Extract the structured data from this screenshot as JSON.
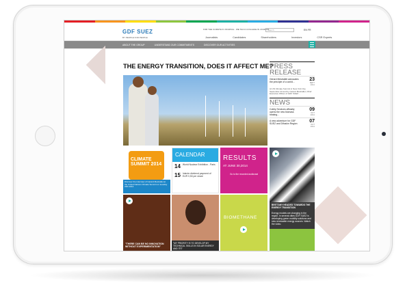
{
  "site": {
    "brand_colors": [
      "#e31e24",
      "#f7941d",
      "#ffdd00",
      "#8dc63f",
      "#00a651",
      "#1cb0a4",
      "#29abe2",
      "#2e3192",
      "#92278f",
      "#d0238b"
    ],
    "logo": "GDF SUEZ",
    "tagline": "BY PEOPLE FOR PEOPLE",
    "utility_links": "FOR THE CLIMATE IN JOURNAL · WE TALK A COLLEGE IN JOURNAL",
    "search_placeholder": "Search",
    "language": "EN FR",
    "main_nav": [
      "Journalists",
      "Candidates",
      "Shareholders",
      "Investors",
      "CSR Experts"
    ],
    "sub_nav": [
      "ABOUT THE GROUP",
      "UNDERSTAND OUR COMMITMENTS",
      "DISCOVER OUR ACTIVITIES"
    ]
  },
  "main": {
    "headline": "THE ENERGY TRANSITION, DOES IT AFFECT ME?"
  },
  "tiles": {
    "climate": {
      "badge": "CLIMATE SUMMIT 2014",
      "badge_sub": "CATALYZING ACTION",
      "caption": "Discover the interview of Gérard Mestrallet at the United Nations Climate Summit on tuesday 23th 2014"
    },
    "calendar": {
      "title": "CALENDAR",
      "events": [
        {
          "day": "14",
          "month": "OCT",
          "text": "World Nuclear Exhibition - Paris"
        },
        {
          "day": "15",
          "month": "OCT",
          "text": "Interim dividend payment of EUR 0,50 per share"
        }
      ]
    },
    "results": {
      "title": "RESULTS",
      "date": "AT JUNE 30,2014",
      "link": "Go to the recorded audiocast"
    },
    "video1": {
      "caption": "\"THERE CAN BE NO INNOVATION WITHOUT EXPERIMENTATION\""
    },
    "woman": {
      "caption": "\"MY PRIORITY IS TO DEVELOP MY TECHNICAL SKILLS IN SOLAR ENERGY AND ITS\""
    },
    "bio": {
      "caption": "BIOMETHANE"
    },
    "flag": {
      "title": "BRITTANY HEADED TOWARDS THE ENERGY TRANSITION",
      "text": "Energy models are changing in the region. In several cities GDF SUEZ is developing green mobility solutions and new renewable energy sources. Watch the video."
    }
  },
  "press": {
    "title": "PRESS RELEASE",
    "items": [
      {
        "text": "Gérard Mestrallet advocates the principle of a world...",
        "day": "23",
        "month": "SEPT",
        "year": "2014"
      }
    ],
    "note": "At UN Climate Summit in New York City, September 23 and by Gérard Mestrallet, Chief Executive Officer of GDF SUEZ..."
  },
  "news": {
    "title": "NEWS",
    "items": [
      {
        "text": "Cofely Services officially opens the new biomass heating...",
        "day": "09",
        "month": "OCT",
        "year": "2014"
      },
      {
        "text": "A new adventure for GDF SUEZ and Difusión Region",
        "day": "07",
        "month": "OCT",
        "year": "2014"
      }
    ]
  }
}
